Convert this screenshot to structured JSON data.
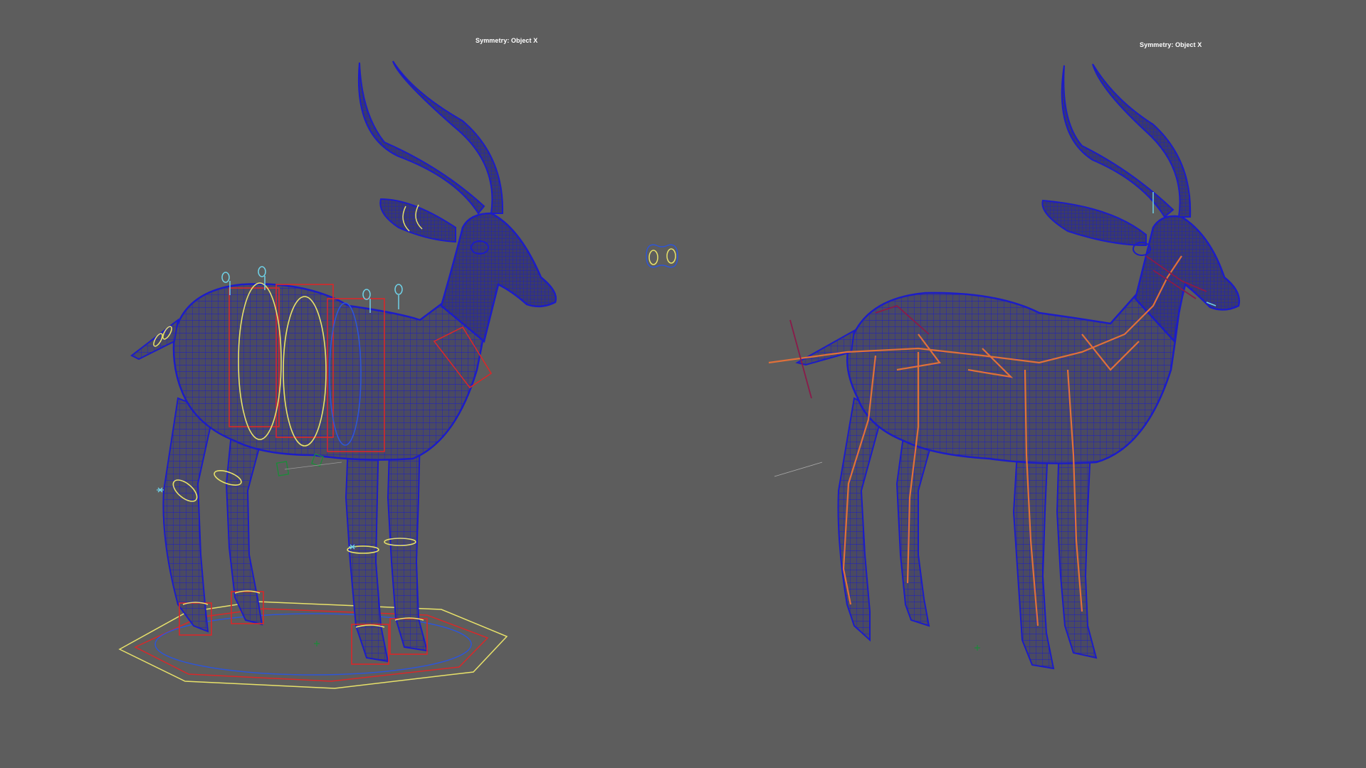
{
  "viewports": {
    "left": {
      "symmetry_label": "Symmetry: Object X"
    },
    "right": {
      "symmetry_label": "Symmetry: Object X"
    }
  },
  "colors": {
    "background": "#5d5d5d",
    "wireframe": "#1c1cc8",
    "mesh_fill": "#4a4a62",
    "control_yellow": "#e8e26a",
    "control_red": "#d8282a",
    "control_cyan": "#6fd2e8",
    "control_blue": "#2e55d8",
    "joint_orange": "#e0703a",
    "pivot_green": "#1d8a3a"
  },
  "icons": {
    "left_model": "rigged-antelope-wireframe",
    "right_model": "skinned-antelope-wireframe-with-joints",
    "floating_control": "eye-aim-control-icon",
    "pivot": "pivot-cross-icon"
  }
}
